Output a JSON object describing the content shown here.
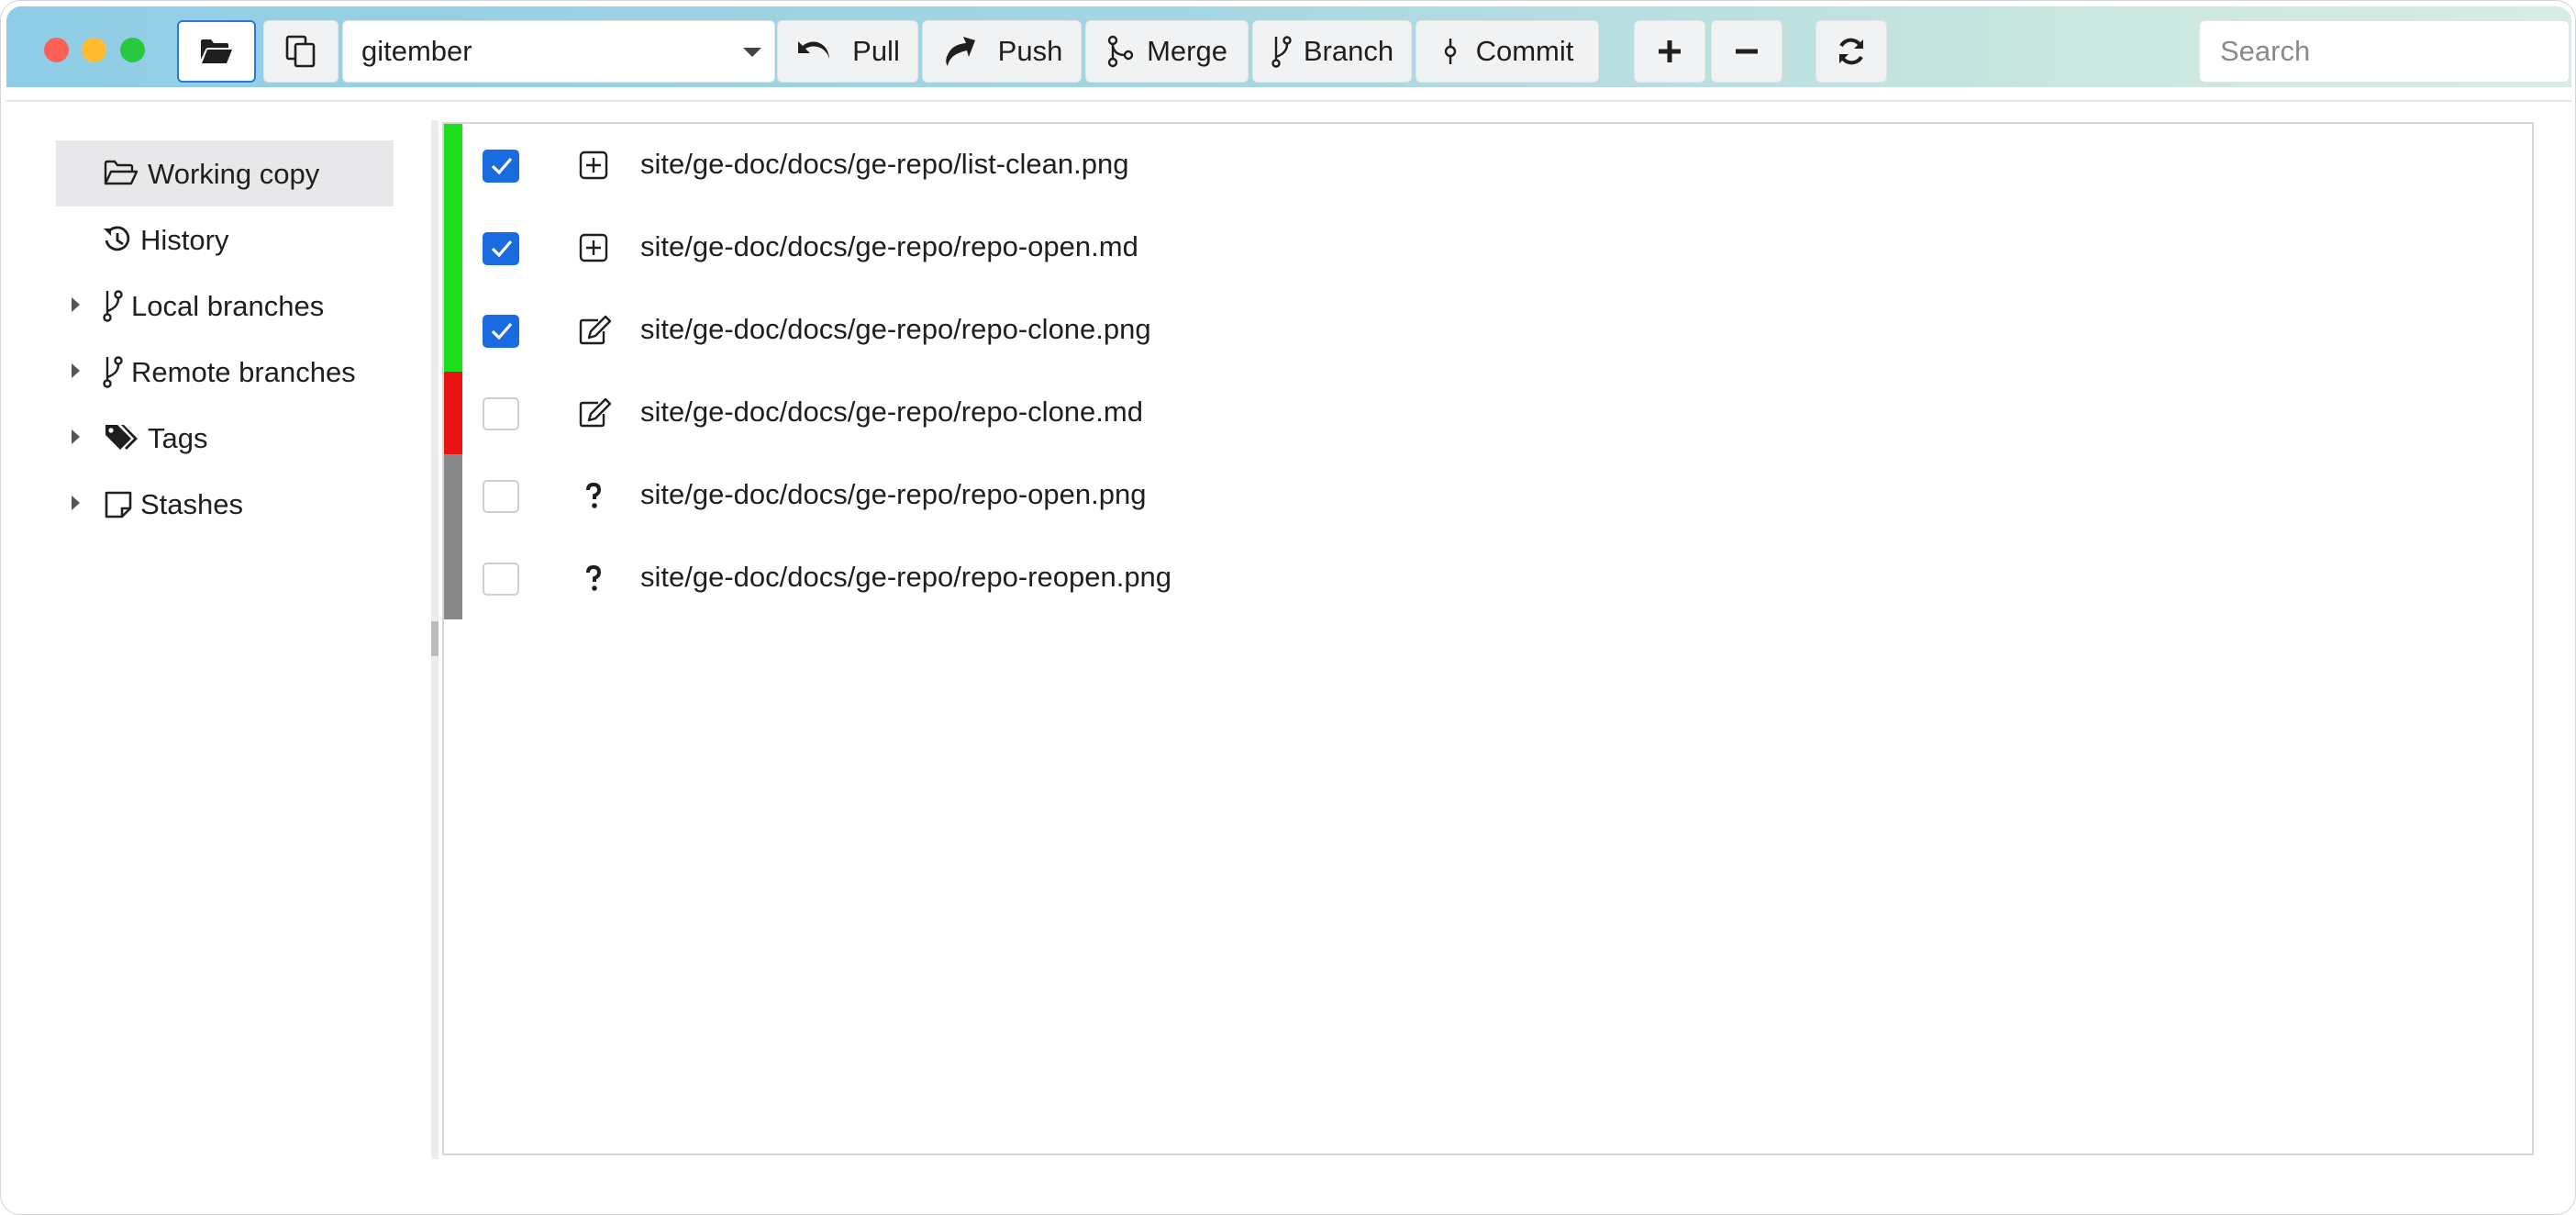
{
  "toolbar": {
    "repo": "gitember",
    "buttons": {
      "pull": "Pull",
      "push": "Push",
      "merge": "Merge",
      "branch": "Branch",
      "commit": "Commit"
    },
    "search_placeholder": "Search"
  },
  "sidebar": {
    "items": [
      {
        "label": "Working copy",
        "icon": "folder-open-icon",
        "selected": true,
        "expandable": false
      },
      {
        "label": "History",
        "icon": "history-icon",
        "selected": false,
        "expandable": false
      },
      {
        "label": "Local branches",
        "icon": "branch-icon",
        "selected": false,
        "expandable": true
      },
      {
        "label": "Remote branches",
        "icon": "branch-icon",
        "selected": false,
        "expandable": true
      },
      {
        "label": "Tags",
        "icon": "tags-icon",
        "selected": false,
        "expandable": true
      },
      {
        "label": "Stashes",
        "icon": "note-icon",
        "selected": false,
        "expandable": true
      }
    ]
  },
  "files": [
    {
      "path": "site/ge-doc/docs/ge-repo/list-clean.png",
      "checked": true,
      "status": "added",
      "status_icon": "plus-square-icon",
      "color": "#1de01d"
    },
    {
      "path": "site/ge-doc/docs/ge-repo/repo-open.md",
      "checked": true,
      "status": "added",
      "status_icon": "plus-square-icon",
      "color": "#1de01d"
    },
    {
      "path": "site/ge-doc/docs/ge-repo/repo-clone.png",
      "checked": true,
      "status": "modified",
      "status_icon": "edit-icon",
      "color": "#1de01d"
    },
    {
      "path": "site/ge-doc/docs/ge-repo/repo-clone.md",
      "checked": false,
      "status": "modified",
      "status_icon": "edit-icon",
      "color": "#e81414"
    },
    {
      "path": "site/ge-doc/docs/ge-repo/repo-open.png",
      "checked": false,
      "status": "untracked",
      "status_icon": "question-icon",
      "color": "#888888"
    },
    {
      "path": "site/ge-doc/docs/ge-repo/repo-reopen.png",
      "checked": false,
      "status": "untracked",
      "status_icon": "question-icon",
      "color": "#888888"
    }
  ]
}
